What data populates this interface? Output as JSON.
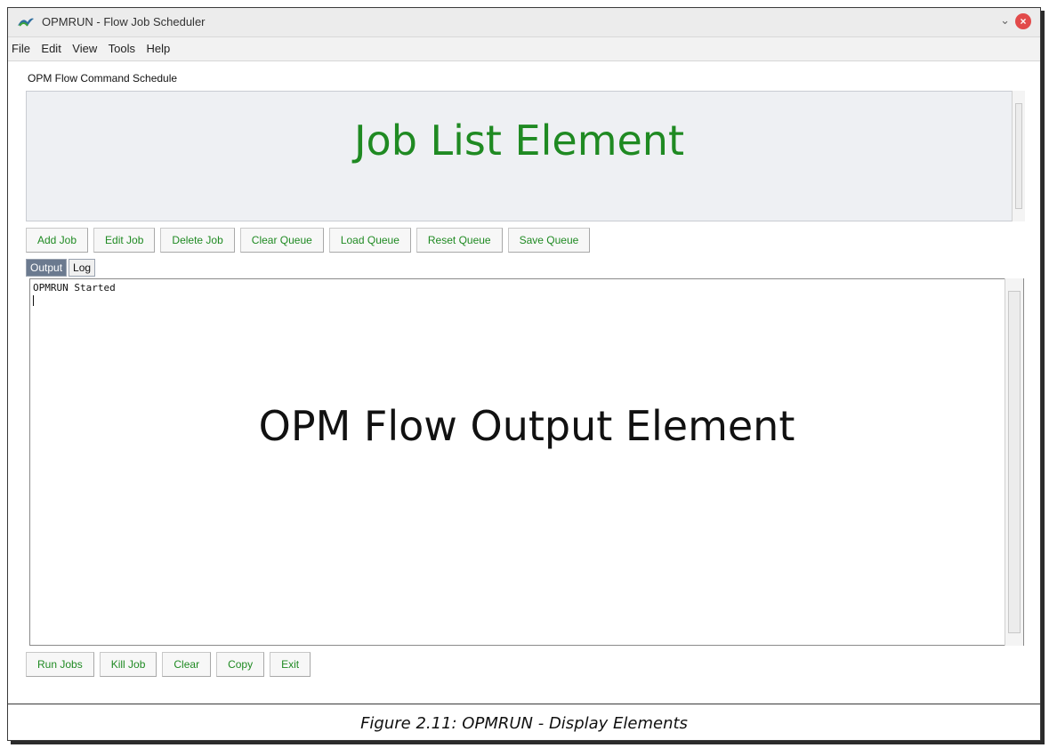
{
  "window": {
    "title": "OPMRUN - Flow Job Scheduler"
  },
  "menu": [
    "File",
    "Edit",
    "View",
    "Tools",
    "Help"
  ],
  "schedule_label": "OPM Flow Command Schedule",
  "joblist": {
    "label": "Job List Element"
  },
  "job_buttons": [
    "Add Job",
    "Edit Job",
    "Delete Job",
    "Clear Queue",
    "Load Queue",
    "Reset Queue",
    "Save Queue"
  ],
  "tabs": [
    "Output",
    "Log"
  ],
  "output": {
    "text": "OPMRUN Started",
    "label": "OPM Flow Output Element"
  },
  "run_buttons": [
    "Run Jobs",
    "Kill Job",
    "Clear",
    "Copy",
    "Exit"
  ],
  "caption": "Figure 2.11: OPMRUN -  Display Elements",
  "colors": {
    "accent": "#1f8a22",
    "tab_active": "#6b7a8f"
  }
}
